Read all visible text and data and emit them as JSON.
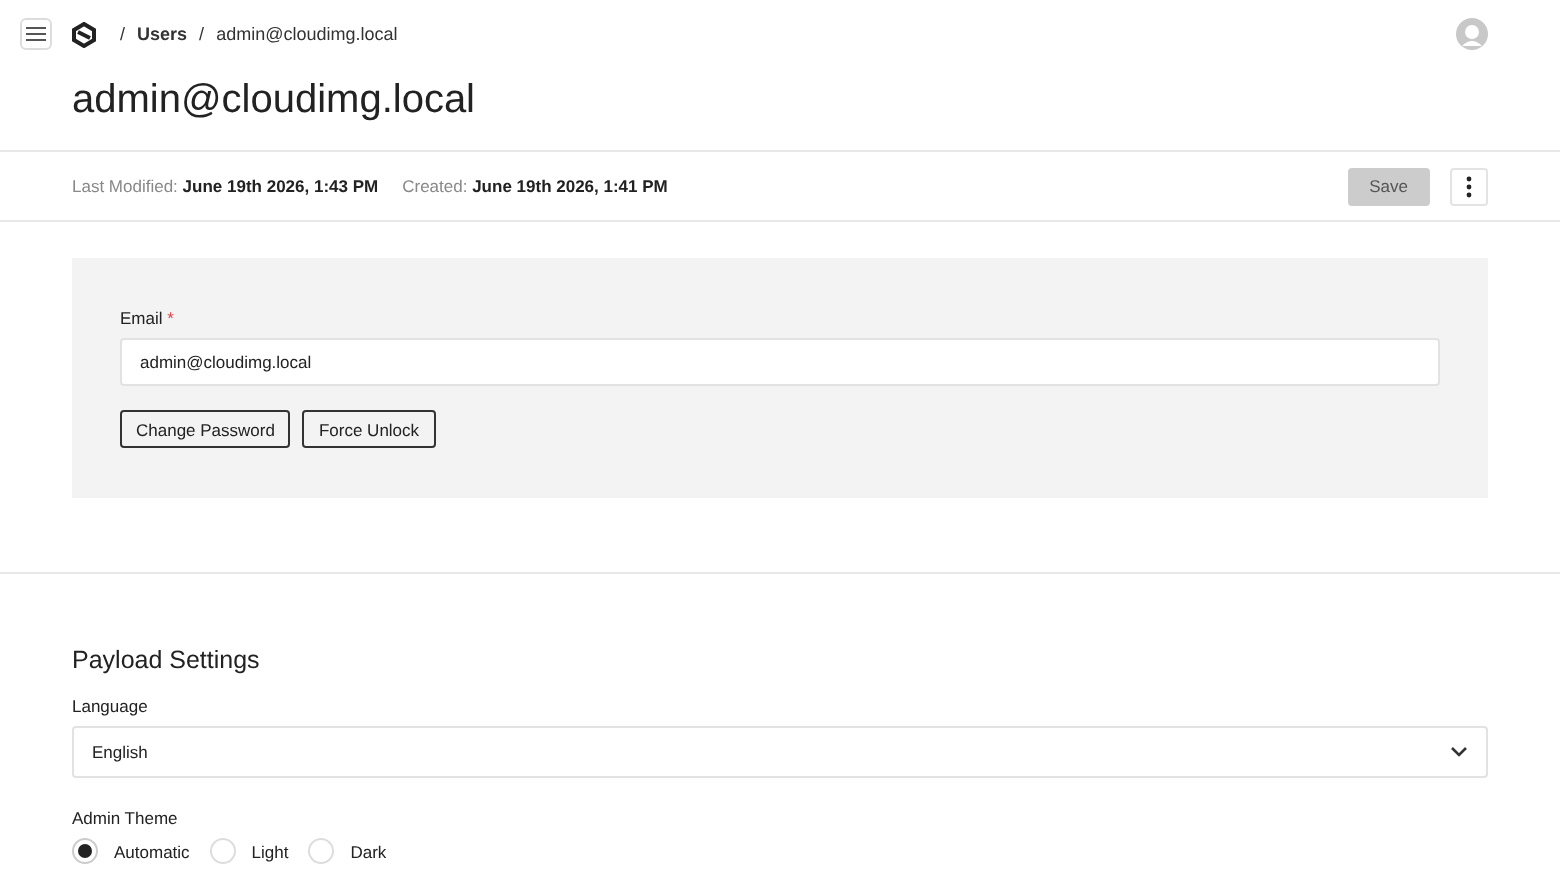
{
  "breadcrumbs": [
    {
      "label": "Users",
      "current": false
    },
    {
      "label": "admin@cloudimg.local",
      "current": true
    }
  ],
  "breadcrumb_separator": "/",
  "title": "admin@cloudimg.local",
  "meta": [
    {
      "label": "Last Modified:",
      "value": "June 19th 2026, 1:43 PM"
    },
    {
      "label": "Created:",
      "value": "June 19th 2026, 1:41 PM"
    }
  ],
  "save_button": {
    "label": "Save",
    "disabled": true
  },
  "email_field": {
    "label": "Email",
    "required_mark": "*",
    "value": "admin@cloudimg.local"
  },
  "actions": [
    "Change Password",
    "Force Unlock"
  ],
  "payload_settings": {
    "heading": "Payload Settings",
    "language": {
      "label": "Language",
      "value": "English"
    },
    "admin_theme": {
      "label": "Admin Theme",
      "options": [
        {
          "label": "Automatic",
          "selected": true
        },
        {
          "label": "Light",
          "selected": false
        },
        {
          "label": "Dark",
          "selected": false
        }
      ]
    }
  }
}
